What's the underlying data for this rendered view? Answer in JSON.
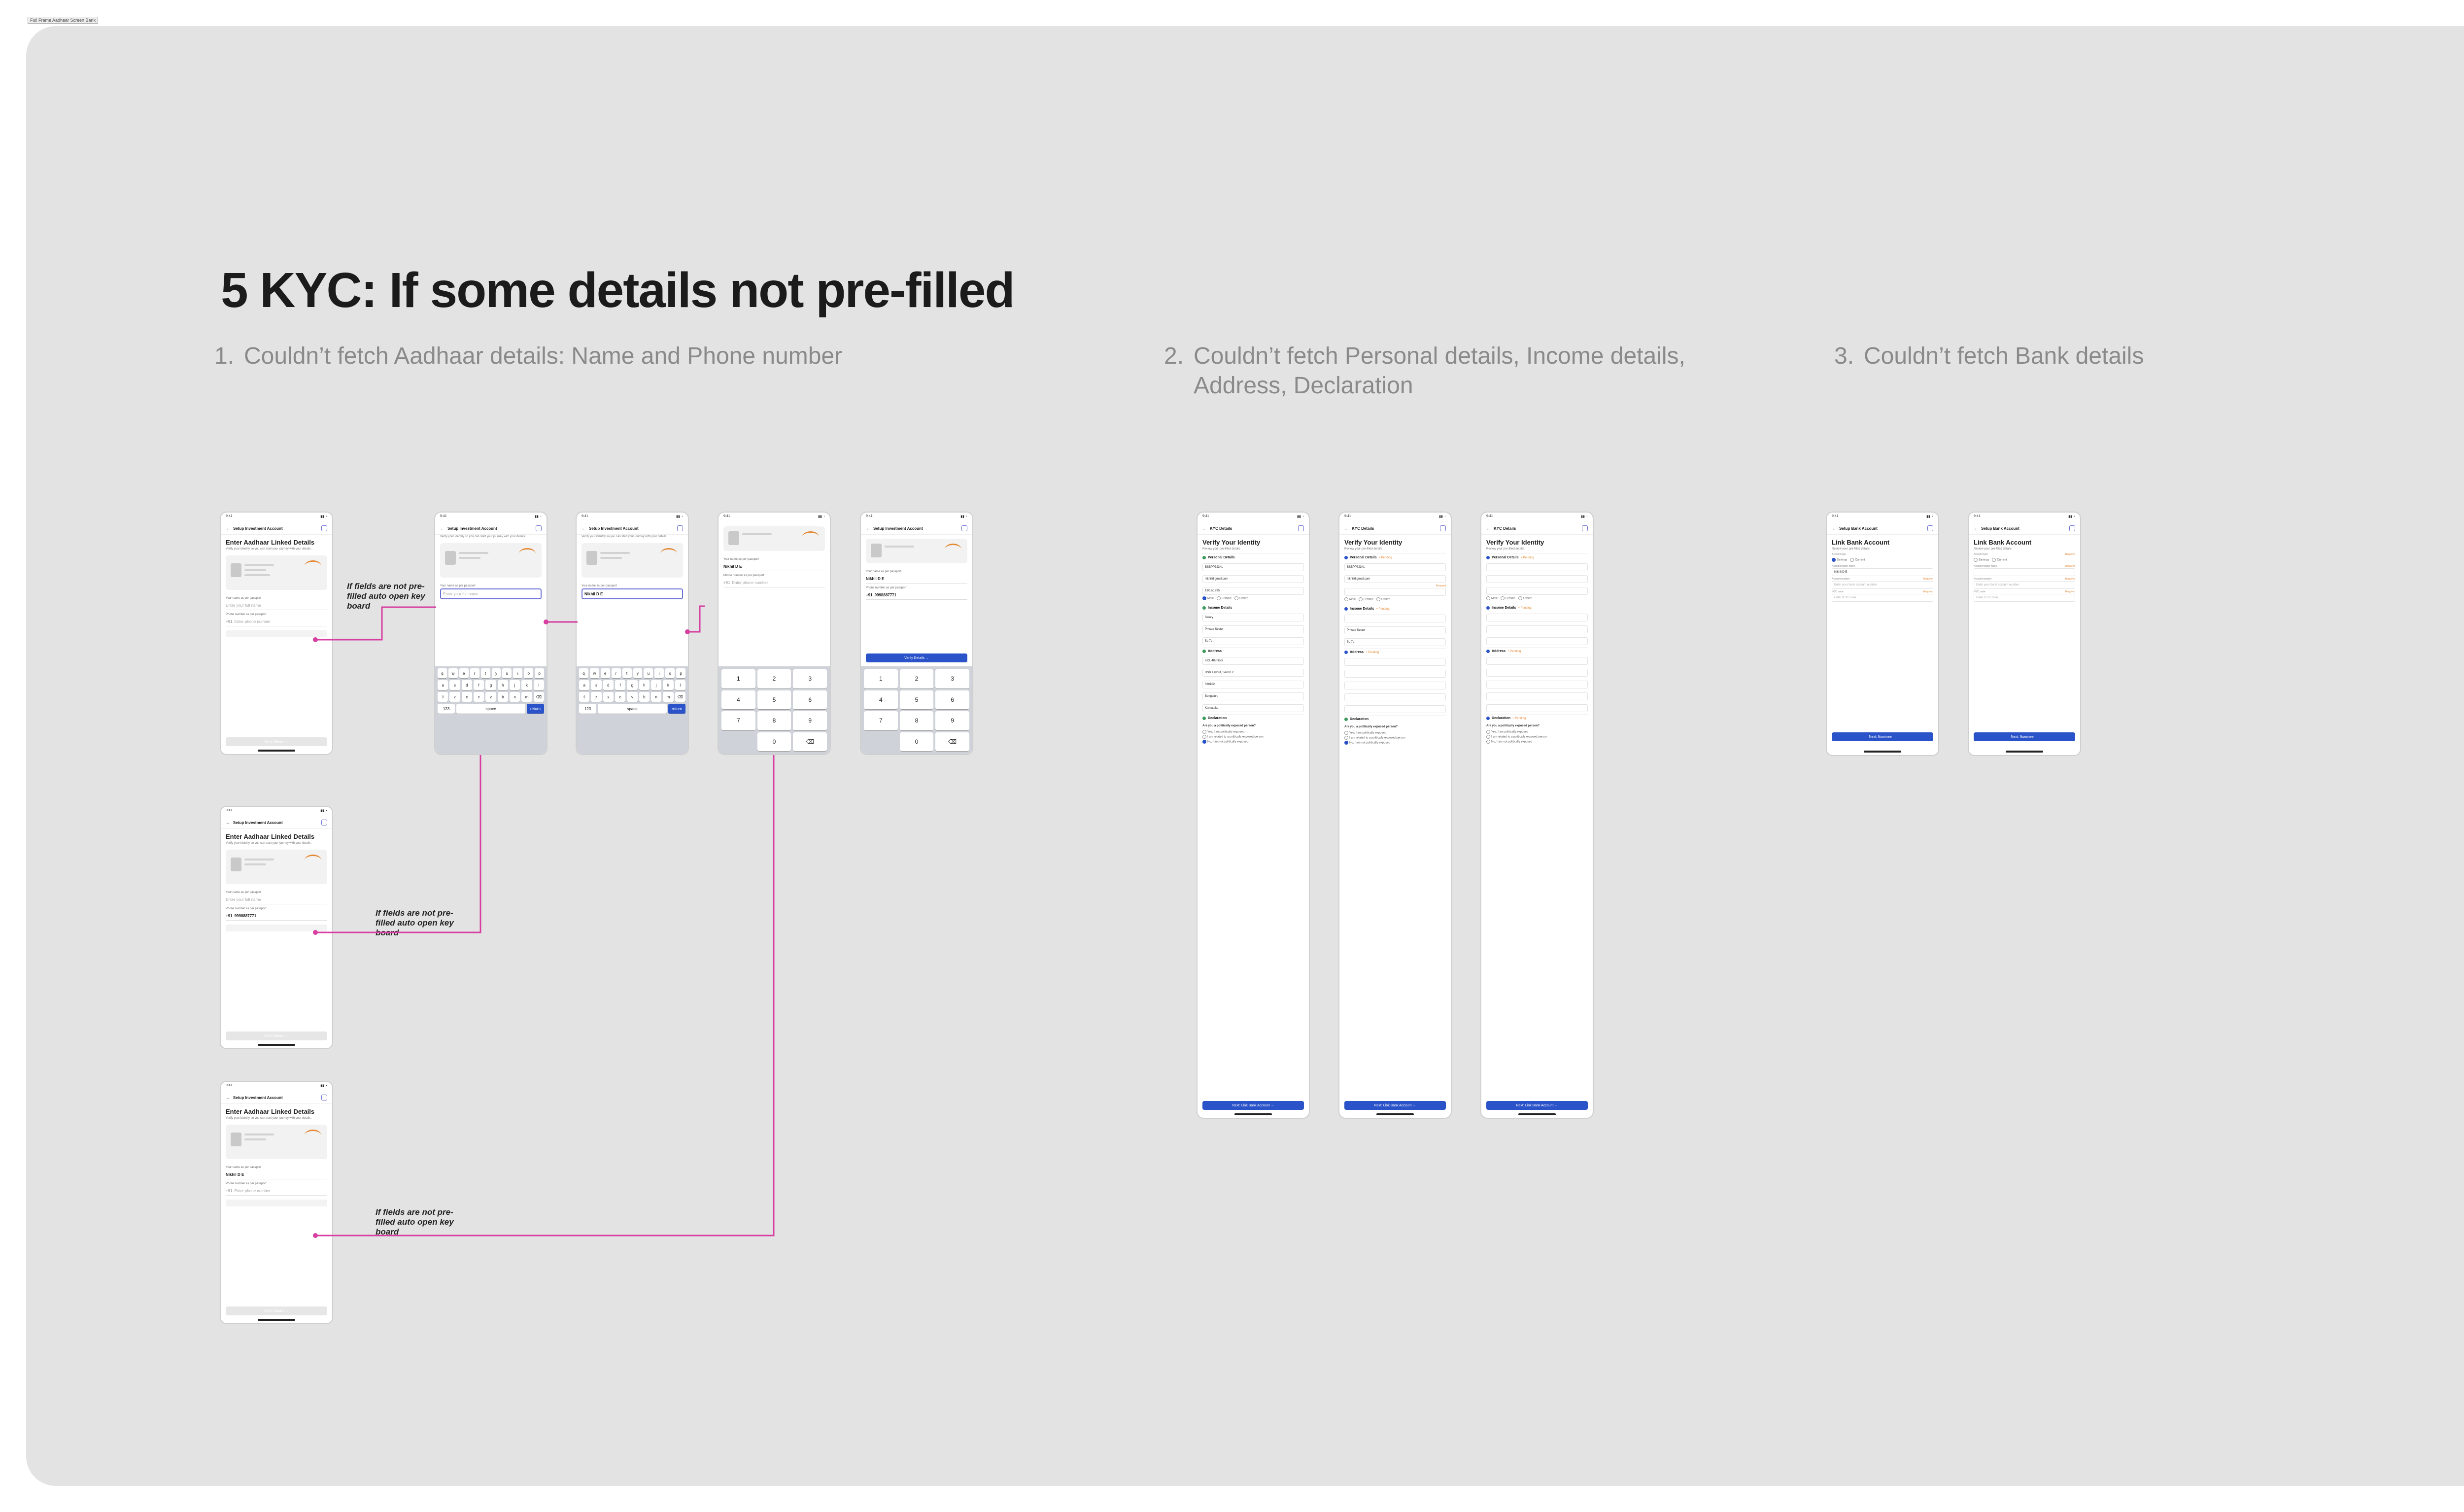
{
  "frame_tag": "Full Frame Aadhaar Screen Bank",
  "title": "5 KYC: If some details not pre-filled",
  "sections": [
    {
      "num": "1.",
      "text": "Couldn’t fetch Aadhaar details: Name and Phone number"
    },
    {
      "num": "2.",
      "text": "Couldn’t fetch Personal details, Income details, Address, Declaration"
    },
    {
      "num": "3.",
      "text": "Couldn’t fetch Bank details"
    }
  ],
  "note": "If fields are not pre-filled auto open key board",
  "colors": {
    "canvas": "#e3e3e3",
    "accent": "#2a52c9",
    "link": "#d63fa0",
    "pending": "#e48a37",
    "done": "#3a9a5b"
  },
  "phone": {
    "status_time": "9:41",
    "aadhaar_header": "Setup Investment Account",
    "aadhaar_heading": "Enter Aadhaar Linked Details",
    "aadhaar_sub": "Verify your identity so you can start your journey with your details.",
    "name_label": "Your name as per passport",
    "name_placeholder": "Enter your full name",
    "name_partial": "Nikhil D E",
    "name_value": "Nikhil D E",
    "phone_label": "Phone number as per passport",
    "phone_prefix": "+91",
    "phone_placeholder": "Enter phone number",
    "phone_value": "9998887771",
    "verify_button": "Verify Details →",
    "kyc_header": "KYC Details",
    "kyc_heading": "Verify Your Identity",
    "kyc_sub": "Review your pre-filled details",
    "personal_details": "Personal Details",
    "income_details": "Income Details",
    "address": "Address",
    "declaration": "Declaration",
    "pending": "+ Pending",
    "required": "Required",
    "pan_value": "BSBPP7234L",
    "email_value": "nikhil@gmail.com",
    "dob_value": "18/12/1995",
    "gender_options": [
      "Male",
      "Female",
      "Others"
    ],
    "source_income": "Salary",
    "occupation": "Private Sector",
    "annual_income": "5L-7L",
    "address1": "#23, 4th Floor",
    "address2": "HSR Layout, Sector 2",
    "pincode": "560102",
    "city": "Bengaluru",
    "state": "Karnataka",
    "pep_question": "Are you a politically exposed person?",
    "pep_options": [
      "Yes, I am politically exposed",
      "I am related to a politically exposed person",
      "No, I am not politically exposed"
    ],
    "kyc_button": "Next: Link Bank Account →",
    "bank_header": "Setup Bank Account",
    "bank_heading": "Link Bank Account",
    "bank_sub": "Review your pre-filled details",
    "account_type": "Account type",
    "account_options": [
      "Savings",
      "Current"
    ],
    "holder_label": "Account holder name",
    "holder_value": "Nikhil D E",
    "account_label": "Account number",
    "account_placeholder": "Enter your bank account number",
    "ifsc_label": "IFSC code",
    "ifsc_placeholder": "Enter IFSC code",
    "bank_button": "Next: Nominee →"
  },
  "keyboard_rows": [
    [
      "q",
      "w",
      "e",
      "r",
      "t",
      "y",
      "u",
      "i",
      "o",
      "p"
    ],
    [
      "a",
      "s",
      "d",
      "f",
      "g",
      "h",
      "j",
      "k",
      "l"
    ],
    [
      "⇧",
      "z",
      "x",
      "c",
      "v",
      "b",
      "n",
      "m",
      "⌫"
    ],
    [
      "123",
      "space",
      "return"
    ]
  ],
  "numpad": [
    "1",
    "2",
    "3",
    "4",
    "5",
    "6",
    "7",
    "8",
    "9",
    "",
    "0",
    "⌫"
  ]
}
